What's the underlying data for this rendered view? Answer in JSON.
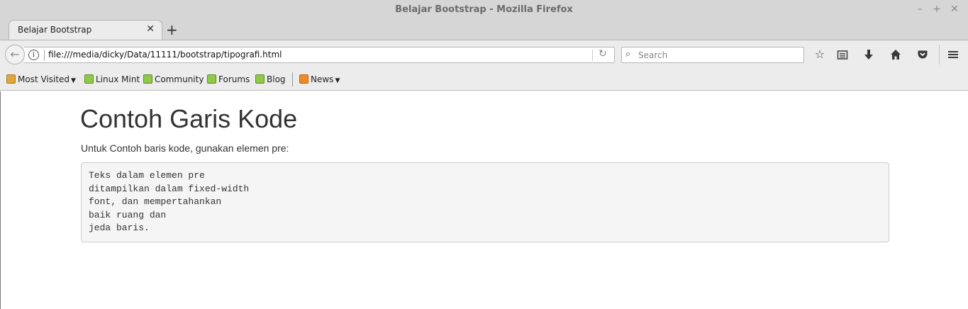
{
  "window": {
    "title": "Belajar Bootstrap - Mozilla Firefox",
    "controls": [
      "–",
      "+",
      "✕"
    ]
  },
  "tabs": [
    {
      "label": "Belajar Bootstrap",
      "close": "✕"
    }
  ],
  "new_tab_label": "+",
  "navbar": {
    "url": "file:///media/dicky/Data/11111/bootstrap/tipografi.html",
    "search_placeholder": "Search",
    "info_glyph": "i",
    "icons": [
      "back-icon",
      "info-icon",
      "reload-icon",
      "search-icon",
      "bookmark-star-icon",
      "reading-list-icon",
      "downloads-icon",
      "home-icon",
      "pocket-icon",
      "menu-icon"
    ]
  },
  "bookmarks": {
    "items": [
      {
        "label": "Most Visited",
        "icon": "folder-icon",
        "dropdown": true
      },
      {
        "label": "Linux Mint",
        "icon": "mint-icon"
      },
      {
        "label": "Community",
        "icon": "mint-icon"
      },
      {
        "label": "Forums",
        "icon": "mint-icon"
      },
      {
        "label": "Blog",
        "icon": "mint-icon"
      },
      {
        "label": "News",
        "icon": "rss-icon",
        "dropdown": true
      }
    ]
  },
  "page": {
    "heading": "Contoh Garis Kode",
    "paragraph": "Untuk Contoh baris kode, gunakan elemen pre:",
    "pre_lines": [
      "Teks dalam elemen pre",
      "ditampilkan dalam fixed-width",
      "font, dan mempertahankan",
      "baik ruang dan",
      "jeda baris."
    ]
  },
  "colors": {
    "chrome": "#d6d6d6",
    "toolbar": "#ececec",
    "text": "#333333",
    "pre_bg": "#f5f5f5",
    "pre_border": "#cccccc"
  }
}
